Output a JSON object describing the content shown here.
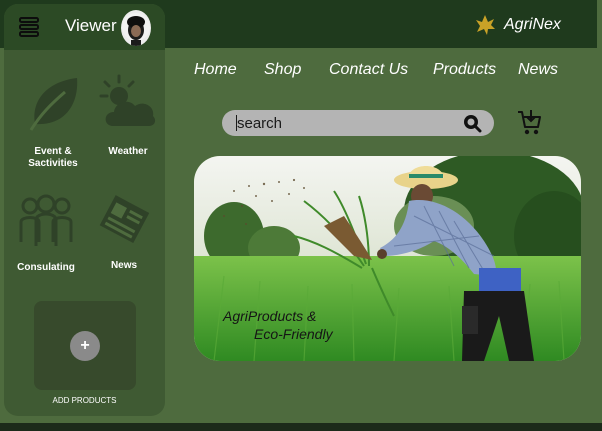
{
  "header": {
    "viewer_label": "Viewer",
    "brand_name": "AgriNex"
  },
  "nav": {
    "items": [
      "Home",
      "Shop",
      "Contact Us",
      "Products",
      "News"
    ]
  },
  "search": {
    "placeholder": "search"
  },
  "sidebar": {
    "items": [
      {
        "label_line1": "Event &",
        "label_line2": "Sactivities",
        "icon": "leaf-icon"
      },
      {
        "label_line1": "Weather",
        "label_line2": "",
        "icon": "weather-icon"
      },
      {
        "label_line1": "Consulating",
        "label_line2": "",
        "icon": "people-icon"
      },
      {
        "label_line1": "News",
        "label_line2": "",
        "icon": "newspaper-icon"
      }
    ],
    "add_symbol": "+",
    "add_label": "ADD PRODUCTS"
  },
  "hero": {
    "line1": "AgriProducts &",
    "line2": "Eco-Friendly"
  },
  "colors": {
    "page_background": "#4e6b3e",
    "topbar": "#1f3a1d",
    "sidebar": "#3f5a33",
    "sidebar_header": "#2c4a25",
    "search_background": "#b4b4b4",
    "brand_accent": "#c9a227"
  }
}
